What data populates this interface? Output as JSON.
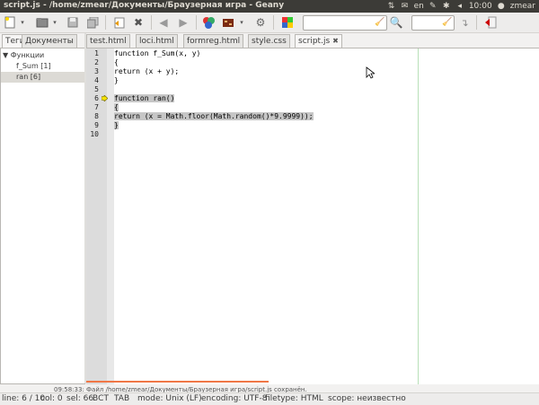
{
  "window": {
    "title": "script.js - /home/zmear/Документы/Браузерная игра - Geany"
  },
  "tray": {
    "lang": "en",
    "clock": "10:00",
    "user": "zmear"
  },
  "toolbar": {
    "buttons": [
      "new-file",
      "open-file",
      "save",
      "save-all",
      "revert",
      "close",
      "back",
      "forward",
      "compile",
      "build",
      "color-chooser",
      "preferences",
      "quit"
    ],
    "search_value": "",
    "goto_value": ""
  },
  "sidebar": {
    "tabs": [
      "Теги",
      "Документы"
    ],
    "active_tab": "Теги",
    "tree": {
      "root": "Функции",
      "items": [
        "f_Sum [1]",
        "ran [6]"
      ],
      "selected": "ran [6]"
    }
  },
  "documents": {
    "tabs": [
      "test.html",
      "loci.html",
      "formreg.html",
      "style.css",
      "script.js"
    ],
    "active": "script.js"
  },
  "editor": {
    "lines": [
      {
        "n": "1",
        "text": "function f_Sum(x, y)"
      },
      {
        "n": "2",
        "text": "{"
      },
      {
        "n": "3",
        "text": "return (x + y);"
      },
      {
        "n": "4",
        "text": "}"
      },
      {
        "n": "5",
        "text": ""
      },
      {
        "n": "6",
        "text": "function ran()"
      },
      {
        "n": "7",
        "text": "{"
      },
      {
        "n": "8",
        "text": "return (x = Math.floor(Math.random()*9.9999));"
      },
      {
        "n": "9",
        "text": "}"
      },
      {
        "n": "10",
        "text": ""
      }
    ]
  },
  "message": "09:58:33: Файл /home/zmear/Документы/Браузерная игра/script.js сохранён.",
  "status": {
    "line": "line: 6 / 10",
    "col": "col: 0",
    "sel": "sel: 66",
    "ins": "ВСТ",
    "tab": "TAB",
    "mode": "mode: Unix (LF)",
    "encoding": "encoding: UTF-8",
    "filetype": "filetype: HTML",
    "scope": "scope: неизвестно"
  },
  "colors": {
    "selection": "#c6c6c6",
    "accent": "#f07746",
    "titlebar": "#3c3b37"
  }
}
